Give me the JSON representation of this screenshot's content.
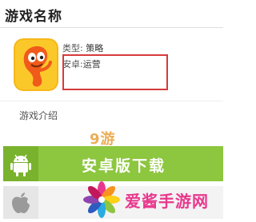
{
  "header": {
    "title": "游戏名称"
  },
  "app": {
    "icon": "mascot-app-icon",
    "type_label": "类型:",
    "type_value": "策略",
    "android_label": "安卓:",
    "android_value": "运营"
  },
  "section": {
    "intro_label": "游戏介绍"
  },
  "download": {
    "android_label": "安卓版下载",
    "android_icon": "android-icon",
    "ios_icon": "apple-icon",
    "accent": "#8dc63f",
    "highlight": "#d63a3a"
  },
  "watermark": {
    "nine_you": "9游",
    "site_name": "爱酱手游网",
    "logo": "pinwheel-logo"
  }
}
